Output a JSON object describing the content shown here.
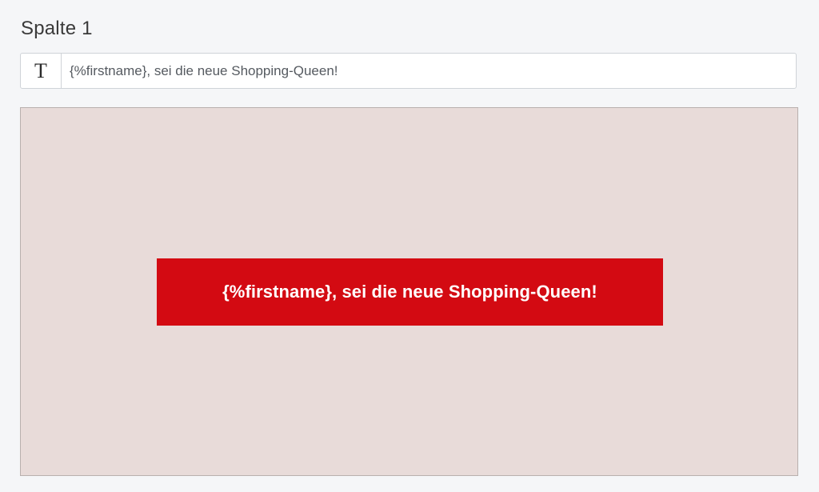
{
  "column": {
    "title": "Spalte 1"
  },
  "text_field": {
    "type_icon": "T",
    "value": "{%firstname}, sei die neue Shopping-Queen!"
  },
  "preview": {
    "background_color": "#e8dbd9",
    "button": {
      "label": "{%firstname}, sei die neue Shopping-Queen!",
      "color": "#d30a12",
      "text_color": "#ffffff"
    }
  }
}
